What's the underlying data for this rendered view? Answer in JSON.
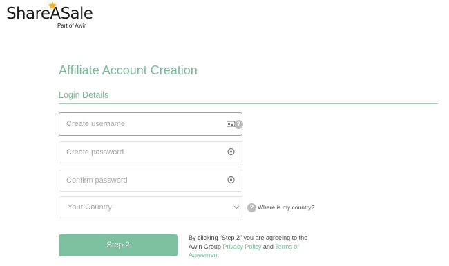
{
  "brand": {
    "name": "ShareASale",
    "tagline": "Part of Awin",
    "star_color": "#f4b62a"
  },
  "page": {
    "title": "Affiliate Account Creation",
    "section_title": "Login Details",
    "accent_color": "#79b99b"
  },
  "form": {
    "username": {
      "placeholder": "Create username",
      "value": "",
      "icon": "contact-card-icon",
      "help_icon": "help-icon"
    },
    "password": {
      "placeholder": "Create password",
      "value": "",
      "icon": "eye-icon"
    },
    "confirm_password": {
      "placeholder": "Confirm password",
      "value": "",
      "icon": "eye-icon"
    },
    "country": {
      "selected": "Your Country",
      "icon": "chevron-down-icon"
    },
    "country_help": {
      "icon": "help-icon",
      "label": "Where is my country?"
    }
  },
  "actions": {
    "step_button": "Step 2",
    "button_color": "#7cc09f"
  },
  "terms": {
    "prefix": "By clicking “Step 2” you are agreeing to the Awin Group ",
    "privacy_link": "Privacy Policy",
    "conjunction": " and ",
    "terms_link": "Terms of Agreement"
  }
}
